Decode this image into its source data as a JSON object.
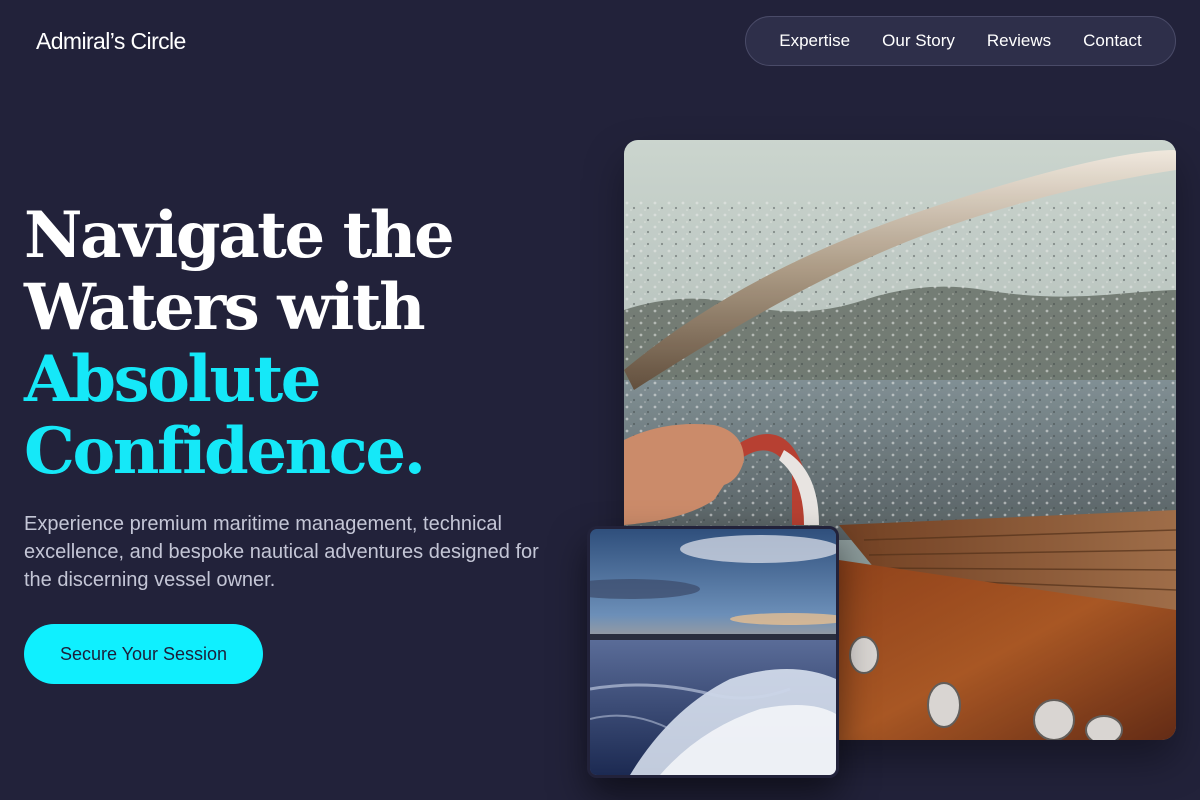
{
  "header": {
    "logo": "Admiral’s Circle",
    "nav": [
      {
        "label": "Expertise"
      },
      {
        "label": "Our Story"
      },
      {
        "label": "Reviews"
      },
      {
        "label": "Contact"
      }
    ]
  },
  "hero": {
    "headline_line1": "Navigate the",
    "headline_line2": "Waters with",
    "headline_accent1": "Absolute",
    "headline_accent2": "Confidence.",
    "subtext": "Experience premium maritime management, technical excellence, and bespoke nautical adventures designed for the discerning vessel owner.",
    "cta_label": "Secure Your Session"
  },
  "colors": {
    "background": "#22223a",
    "accent": "#15e8f8",
    "nav_pill": "#2e2f4a"
  },
  "images": {
    "main": "boat-windshield-photo",
    "inset": "sunset-wake-photo"
  }
}
